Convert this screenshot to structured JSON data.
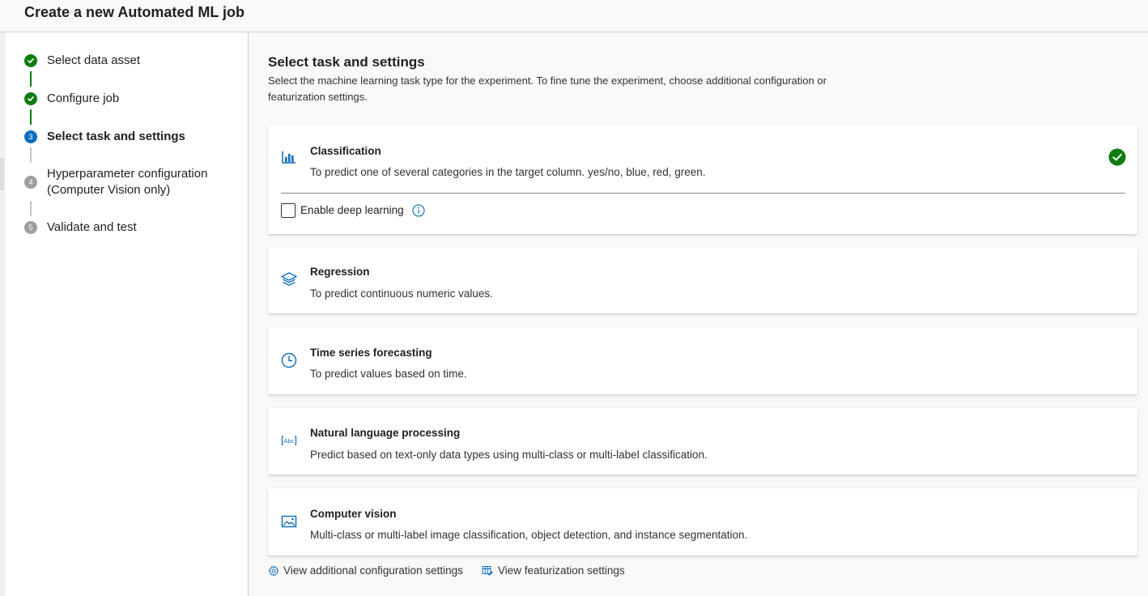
{
  "header": {
    "title": "Create a new Automated ML job"
  },
  "wizard": {
    "steps": [
      {
        "number": "1",
        "label": "Select data asset",
        "state": "done"
      },
      {
        "number": "2",
        "label": "Configure job",
        "state": "done"
      },
      {
        "number": "3",
        "label": "Select task and settings",
        "state": "active"
      },
      {
        "number": "4",
        "label_line1": "Hyperparameter configuration",
        "label_line2": "(Computer Vision only)",
        "state": "pending"
      },
      {
        "number": "5",
        "label": "Validate and test",
        "state": "pending"
      }
    ]
  },
  "main": {
    "title": "Select task and settings",
    "description": "Select the machine learning task type for the experiment. To fine tune the experiment, choose additional configuration or featurization settings.",
    "tasks": [
      {
        "icon": "bar-chart-icon",
        "title": "Classification",
        "description": "To predict one of several categories in the target column. yes/no, blue, red, green.",
        "selected": true,
        "option_label": "Enable deep learning",
        "option_checked": false
      },
      {
        "icon": "layers-icon",
        "title": "Regression",
        "description": "To predict continuous numeric values."
      },
      {
        "icon": "clock-icon",
        "title": "Time series forecasting",
        "description": "To predict values based on time."
      },
      {
        "icon": "text-abc-icon",
        "title": "Natural language processing",
        "description": "Predict based on text-only data types using multi-class or multi-label classification."
      },
      {
        "icon": "image-icon",
        "title": "Computer vision",
        "description": "Multi-class or multi-label image classification, object detection, and instance segmentation."
      }
    ],
    "links": {
      "additional_config": "View additional configuration settings",
      "featurization": "View featurization settings"
    }
  },
  "colors": {
    "accent": "#0f6cbd",
    "success": "#107c10",
    "pending": "#a19f9d"
  }
}
